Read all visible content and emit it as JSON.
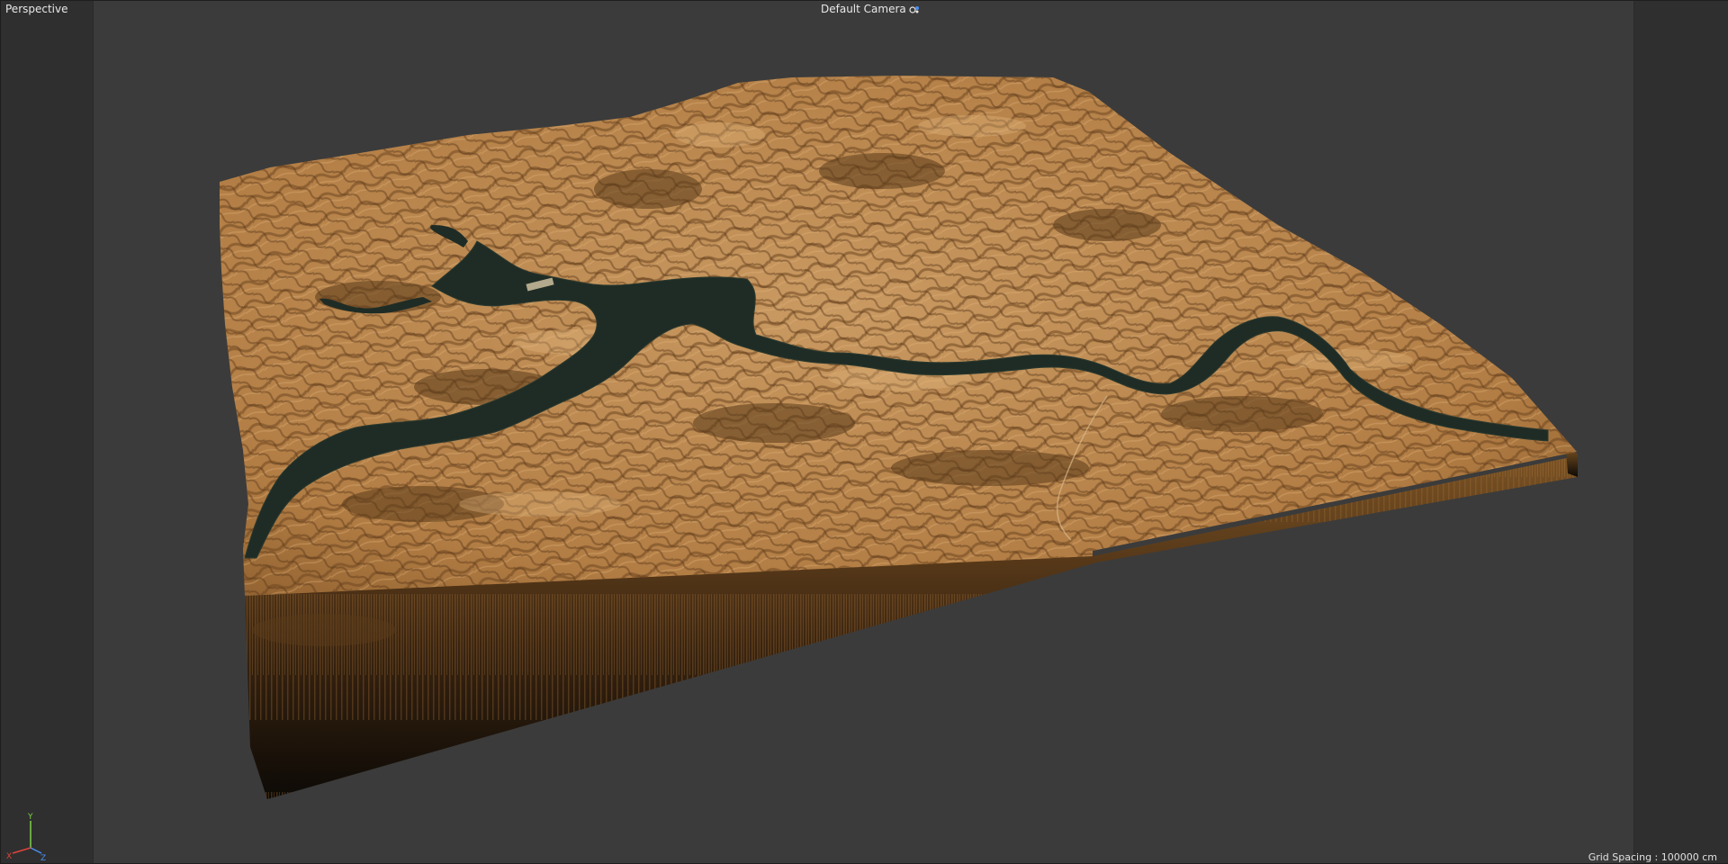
{
  "viewport": {
    "view_name": "Perspective",
    "camera_name": "Default Camera",
    "camera_icon": "camera-target-icon",
    "grid_spacing": "Grid Spacing : 100000 cm"
  },
  "axis_gizmo": {
    "x_label": "X",
    "y_label": "Y",
    "z_label": "Z",
    "x_color": "#e0443c",
    "y_color": "#7fd04a",
    "z_color": "#4a8ef0"
  },
  "colors": {
    "viewport_bg": "#3b3b3b",
    "safe_frame": "#2f2f2f",
    "terrain_light": "#c8955a",
    "terrain_dark": "#5a3a1c",
    "water": "#1e2b24"
  }
}
